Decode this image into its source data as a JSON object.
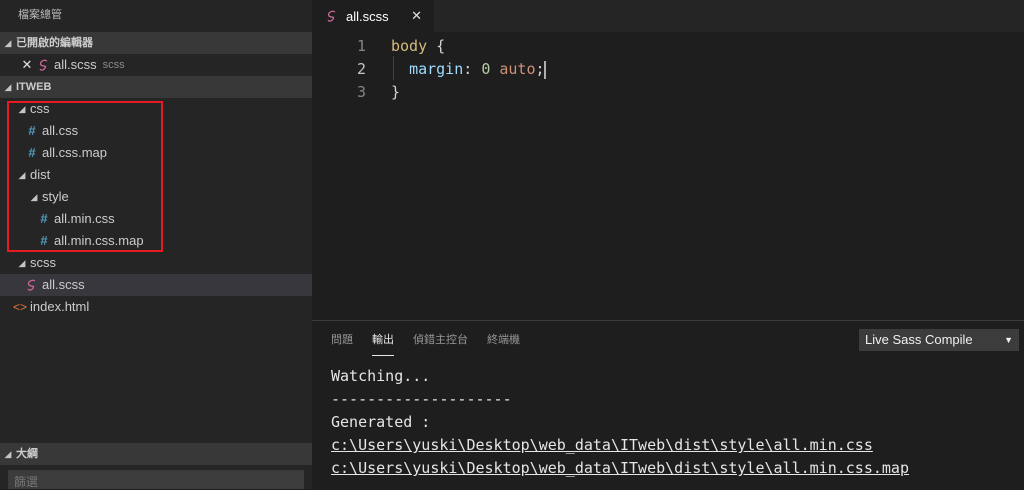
{
  "sidebar": {
    "title": "檔案總管",
    "open_editors": {
      "header": "已開啟的編輯器",
      "items": [
        {
          "name": "all.scss",
          "desc": "scss"
        }
      ]
    },
    "project": {
      "header": "ITWEB",
      "tree": {
        "css": "css",
        "all_css": "all.css",
        "all_css_map": "all.css.map",
        "dist": "dist",
        "style": "style",
        "all_min_css": "all.min.css",
        "all_min_css_map": "all.min.css.map",
        "scss": "scss",
        "all_scss": "all.scss",
        "index_html": "index.html"
      }
    },
    "outline": {
      "header": "大綱",
      "filter_placeholder": "篩選"
    }
  },
  "editor": {
    "tab": {
      "label": "all.scss"
    },
    "lines": [
      {
        "num": "1",
        "sel": "body",
        "brace": " {"
      },
      {
        "num": "2",
        "prop": "margin",
        "colon": ": ",
        "n": "0",
        "kw": "auto",
        "semi": ";"
      },
      {
        "num": "3",
        "close": "}"
      }
    ]
  },
  "panel": {
    "tabs": [
      "問題",
      "輸出",
      "偵錯主控台",
      "終端機"
    ],
    "active_tab": "輸出",
    "channel": "Live Sass Compile",
    "output": [
      "Watching...",
      "--------------------",
      "Generated :",
      "c:\\Users\\yuski\\Desktop\\web_data\\ITweb\\dist\\style\\all.min.css",
      "c:\\Users\\yuski\\Desktop\\web_data\\ITweb\\dist\\style\\all.min.css.map"
    ]
  },
  "colors": {
    "highlight_box": "#e51b24",
    "css_icon": "#519aba",
    "sass_icon": "#cd6799",
    "html_icon": "#e37933"
  },
  "icons": {
    "sass": "sass-file-icon",
    "css": "css-hash-icon",
    "html": "html-brackets-icon"
  }
}
